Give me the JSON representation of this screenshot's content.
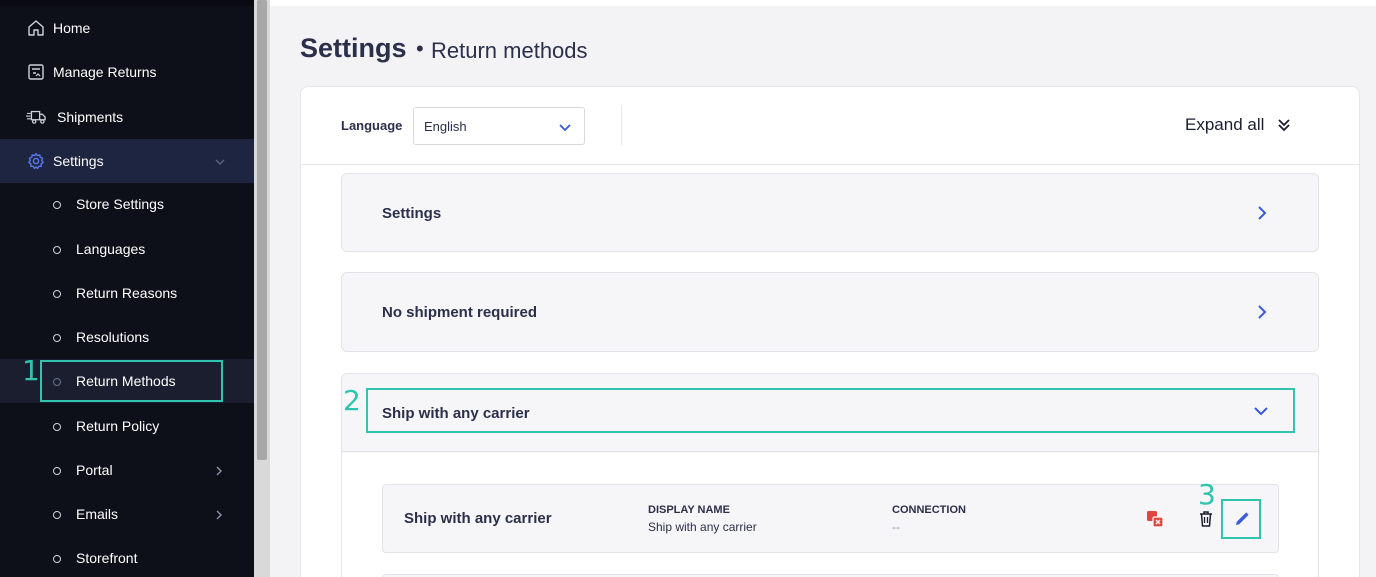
{
  "sidebar": {
    "items": [
      {
        "label": "Home",
        "icon": "home-icon"
      },
      {
        "label": "Manage Returns",
        "icon": "returns-box-icon"
      },
      {
        "label": "Shipments",
        "icon": "truck-icon"
      },
      {
        "label": "Settings",
        "icon": "gear-icon"
      }
    ],
    "sub_items": [
      {
        "label": "Store Settings"
      },
      {
        "label": "Languages"
      },
      {
        "label": "Return Reasons"
      },
      {
        "label": "Resolutions"
      },
      {
        "label": "Return Methods"
      },
      {
        "label": "Return Policy"
      },
      {
        "label": "Portal"
      },
      {
        "label": "Emails"
      },
      {
        "label": "Storefront"
      }
    ]
  },
  "header": {
    "title": "Settings",
    "separator": "•",
    "subtitle": "Return methods"
  },
  "toolbar": {
    "language_label": "Language",
    "language_value": "English",
    "expand_all_label": "Expand all"
  },
  "sections": [
    {
      "title": "Settings"
    },
    {
      "title": "No shipment required"
    },
    {
      "title": "Ship with any carrier"
    }
  ],
  "method_row": {
    "name": "Ship with any carrier",
    "display_name_header": "DISPLAY NAME",
    "display_name_value": "Ship with any carrier",
    "connection_header": "CONNECTION",
    "connection_value": "--"
  },
  "annotations": [
    "1",
    "2",
    "3"
  ],
  "colors": {
    "sidebar_bg": "#0d0f19",
    "active_nav_bg": "#1d2540",
    "accent_blue": "#3a5bd9",
    "annotation_teal": "#2fc4ad",
    "danger_red": "#e0473c"
  }
}
